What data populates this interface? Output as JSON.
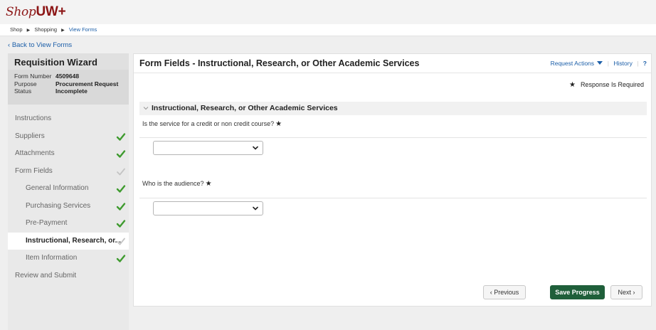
{
  "header": {
    "logo_shop": "Shop",
    "logo_uw": "UW",
    "logo_plus": "+",
    "breadcrumb": [
      "Shop",
      "Shopping",
      "View Forms"
    ],
    "back_link": "Back to View Forms"
  },
  "wizard": {
    "title": "Requisition Wizard",
    "meta": [
      {
        "key": "Form Number",
        "value": "4509648"
      },
      {
        "key": "Purpose",
        "value": "Procurement Request"
      },
      {
        "key": "Status",
        "value": "Incomplete"
      }
    ],
    "nav": [
      {
        "label": "Instructions",
        "check": "none"
      },
      {
        "label": "Suppliers",
        "check": "complete"
      },
      {
        "label": "Attachments",
        "check": "complete"
      },
      {
        "label": "Form Fields",
        "check": "pending"
      },
      {
        "label": "General Information",
        "check": "complete"
      },
      {
        "label": "Purchasing Services",
        "check": "complete"
      },
      {
        "label": "Pre-Payment",
        "check": "complete"
      },
      {
        "label": "Instructional, Research, or...",
        "check": "pending"
      },
      {
        "label": "Item Information",
        "check": "complete"
      },
      {
        "label": "Review and Submit",
        "check": "none"
      }
    ]
  },
  "main": {
    "title": "Form Fields - Instructional, Research, or Other Academic Services",
    "request_actions": "Request Actions",
    "history": "History",
    "help": "?",
    "required_note": "Response Is Required",
    "section_title": "Instructional, Research, or Other Academic Services",
    "questions": [
      {
        "label": "Is the service for a credit or non credit course?",
        "value": ""
      },
      {
        "label": "Who is the audience?",
        "value": ""
      }
    ],
    "buttons": {
      "previous": "Previous",
      "save": "Save Progress",
      "next": "Next"
    }
  },
  "colors": {
    "brand": "#8c1515",
    "link": "#1b5ea8",
    "check_complete": "#3f9b2f",
    "check_pending": "#bdbdbd",
    "save_button": "#1f5f3a"
  }
}
